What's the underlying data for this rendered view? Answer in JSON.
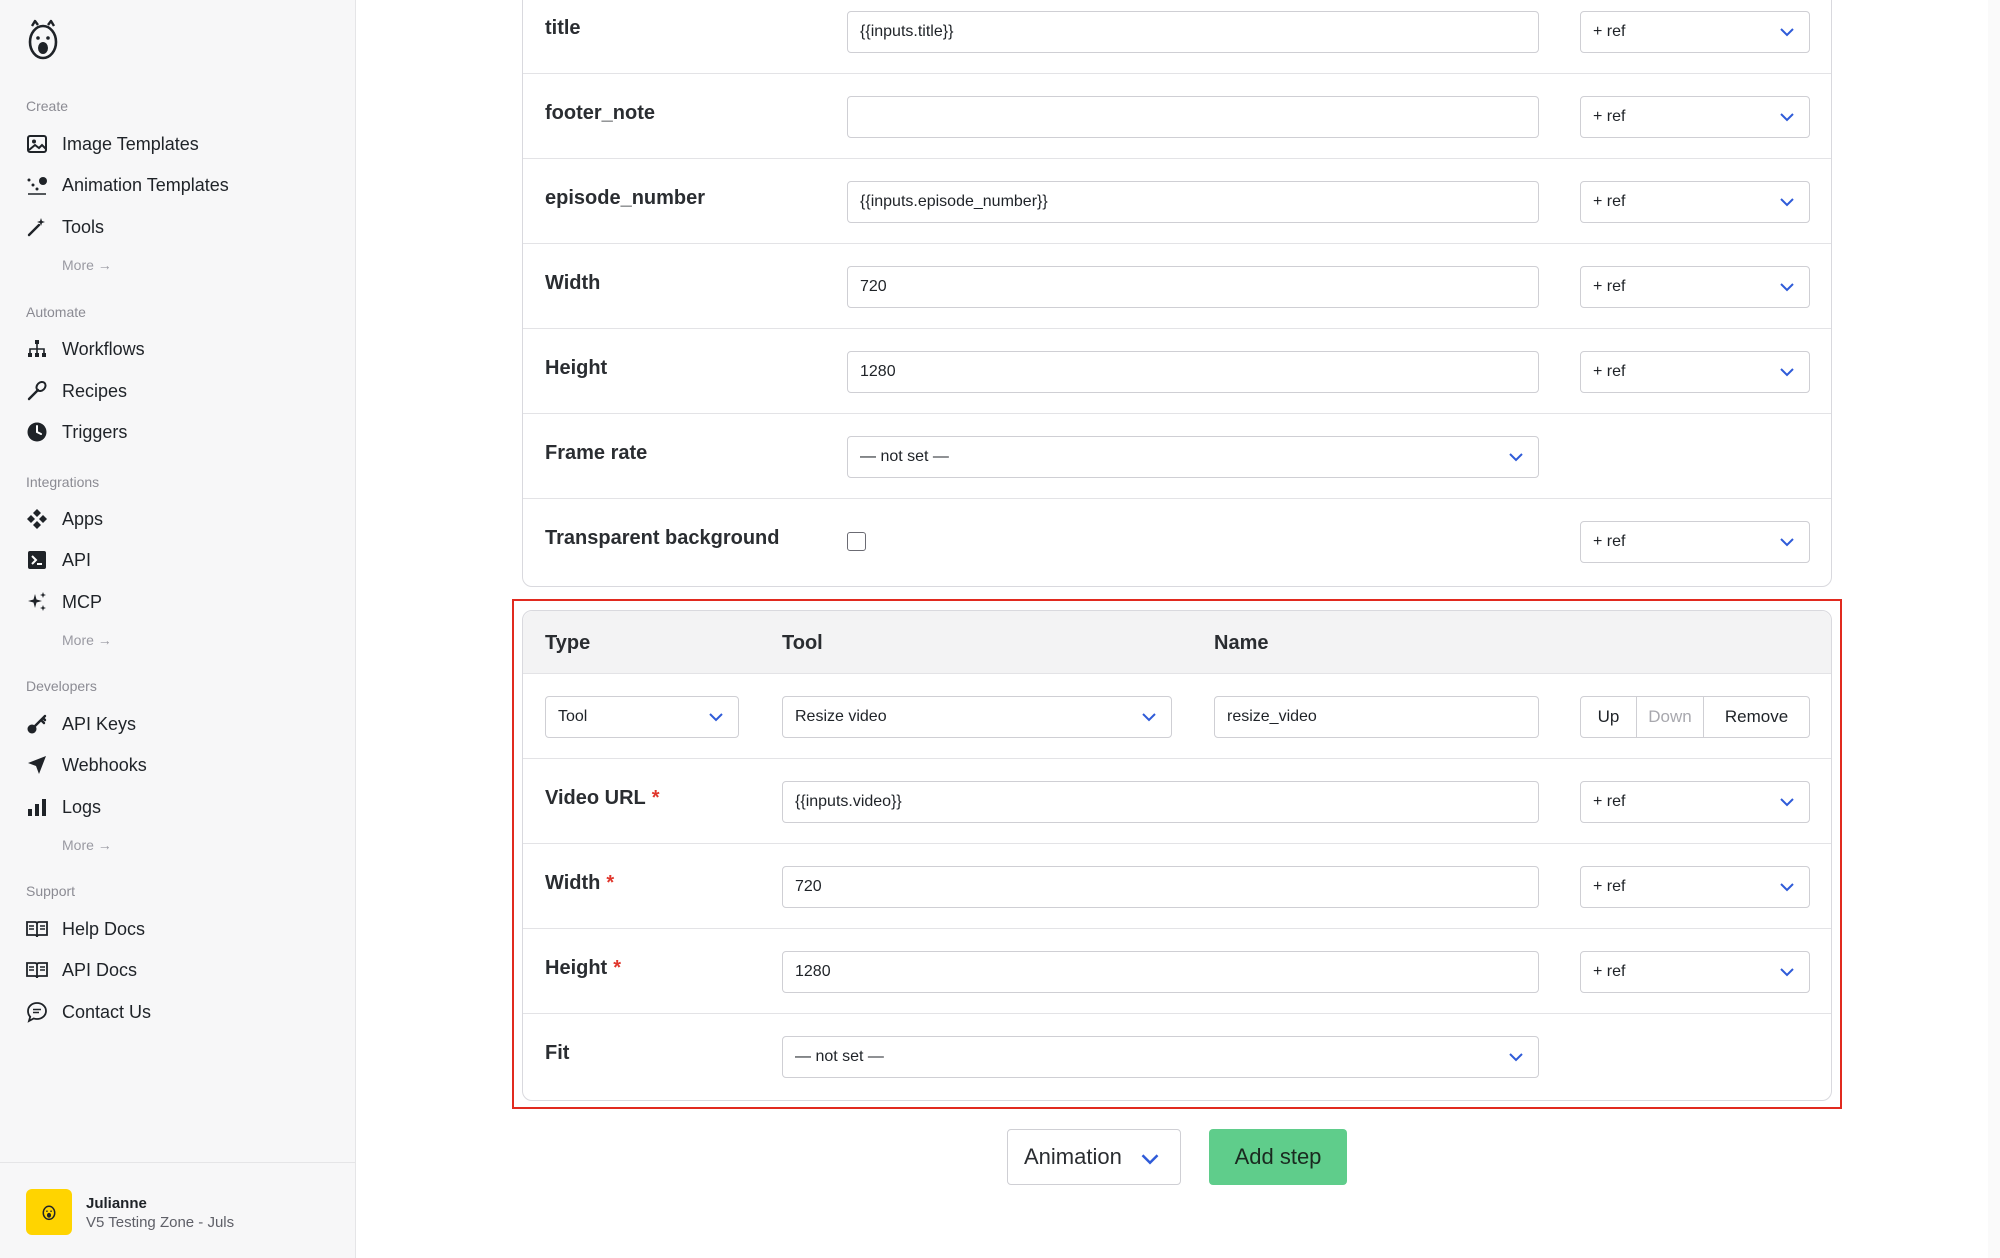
{
  "sidebar": {
    "sections": {
      "create": "Create",
      "automate": "Automate",
      "integrations": "Integrations",
      "developers": "Developers",
      "support": "Support"
    },
    "items": {
      "image_templates": "Image Templates",
      "animation_templates": "Animation Templates",
      "tools": "Tools",
      "workflows": "Workflows",
      "recipes": "Recipes",
      "triggers": "Triggers",
      "apps": "Apps",
      "api": "API",
      "mcp": "MCP",
      "api_keys": "API Keys",
      "webhooks": "Webhooks",
      "logs": "Logs",
      "help_docs": "Help Docs",
      "api_docs": "API Docs",
      "contact_us": "Contact Us"
    },
    "more": "More →",
    "user": {
      "name": "Julianne",
      "team": "V5 Testing Zone - Juls"
    }
  },
  "previous_step": {
    "rows": [
      {
        "label": "title",
        "value": "{{inputs.title}}",
        "ref": "+ ref"
      },
      {
        "label": "footer_note",
        "value": "",
        "ref": "+ ref"
      },
      {
        "label": "episode_number",
        "value": "{{inputs.episode_number}}",
        "ref": "+ ref"
      },
      {
        "label": "Width",
        "value": "720",
        "ref": "+ ref"
      },
      {
        "label": "Height",
        "value": "1280",
        "ref": "+ ref"
      },
      {
        "label": "Frame rate",
        "value": "— not set —"
      },
      {
        "label": "Transparent background",
        "checked": false,
        "ref": "+ ref"
      }
    ]
  },
  "step": {
    "headers": {
      "type": "Type",
      "tool": "Tool",
      "name": "Name"
    },
    "type_value": "Tool",
    "tool_value": "Resize video",
    "name_value": "resize_video",
    "buttons": {
      "up": "Up",
      "down": "Down",
      "remove": "Remove"
    },
    "fields": [
      {
        "label": "Video URL",
        "required": "*",
        "value": "{{inputs.video}}",
        "ref": "+ ref"
      },
      {
        "label": "Width",
        "required": "*",
        "value": "720",
        "ref": "+ ref"
      },
      {
        "label": "Height",
        "required": "*",
        "value": "1280",
        "ref": "+ ref"
      },
      {
        "label": "Fit",
        "value": "— not set —"
      }
    ]
  },
  "footer": {
    "step_kind": "Animation",
    "add_step": "Add step"
  },
  "colors": {
    "accent": "#2f5bd8",
    "add_step_bg": "#5fcd8b",
    "highlight": "#e12a1f",
    "required": "#e0362c",
    "avatar": "#ffd400"
  }
}
